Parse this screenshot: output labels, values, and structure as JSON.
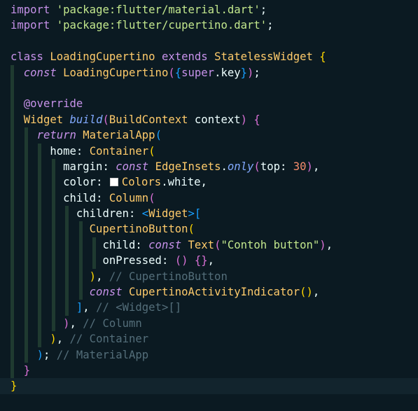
{
  "editor": {
    "language": "dart",
    "colors": {
      "background": "#0b1a22",
      "current_line": "#12242d",
      "keyword": "#c792ea",
      "string": "#c3e88d",
      "class": "#ffcb6b",
      "function": "#82aaff",
      "number": "#f78c6c",
      "comment": "#546e7a",
      "guide": "#1f3a30"
    },
    "current_line_index": 24,
    "lines": [
      {
        "indent": 0,
        "tokens": [
          {
            "t": "import",
            "c": "kw"
          },
          {
            "t": " "
          },
          {
            "t": "'package:flutter/material.dart'",
            "c": "str"
          },
          {
            "t": ";",
            "c": "id"
          }
        ]
      },
      {
        "indent": 0,
        "tokens": [
          {
            "t": "import",
            "c": "kw"
          },
          {
            "t": " "
          },
          {
            "t": "'package:flutter/cupertino.dart'",
            "c": "str"
          },
          {
            "t": ";",
            "c": "id"
          }
        ]
      },
      {
        "indent": 0,
        "tokens": []
      },
      {
        "indent": 0,
        "tokens": [
          {
            "t": "class",
            "c": "kw"
          },
          {
            "t": " "
          },
          {
            "t": "LoadingCupertino",
            "c": "cls"
          },
          {
            "t": " "
          },
          {
            "t": "extends",
            "c": "kw"
          },
          {
            "t": " "
          },
          {
            "t": "StatelessWidget",
            "c": "cls"
          },
          {
            "t": " "
          },
          {
            "t": "{",
            "c": "br1"
          }
        ]
      },
      {
        "indent": 1,
        "tokens": [
          {
            "t": "const",
            "c": "kwi"
          },
          {
            "t": " "
          },
          {
            "t": "LoadingCupertino",
            "c": "cls"
          },
          {
            "t": "(",
            "c": "br2"
          },
          {
            "t": "{",
            "c": "br3"
          },
          {
            "t": "super",
            "c": "kw"
          },
          {
            "t": ".",
            "c": "id"
          },
          {
            "t": "key",
            "c": "prop"
          },
          {
            "t": "}",
            "c": "br3"
          },
          {
            "t": ")",
            "c": "br2"
          },
          {
            "t": ";",
            "c": "id"
          }
        ]
      },
      {
        "indent": 1,
        "tokens": []
      },
      {
        "indent": 1,
        "tokens": [
          {
            "t": "@override",
            "c": "kw"
          }
        ]
      },
      {
        "indent": 1,
        "tokens": [
          {
            "t": "Widget",
            "c": "cls"
          },
          {
            "t": " "
          },
          {
            "t": "build",
            "c": "fni"
          },
          {
            "t": "(",
            "c": "br2"
          },
          {
            "t": "BuildContext",
            "c": "cls"
          },
          {
            "t": " "
          },
          {
            "t": "context",
            "c": "id"
          },
          {
            "t": ")",
            "c": "br2"
          },
          {
            "t": " "
          },
          {
            "t": "{",
            "c": "br2"
          }
        ]
      },
      {
        "indent": 2,
        "tokens": [
          {
            "t": "return",
            "c": "kwi"
          },
          {
            "t": " "
          },
          {
            "t": "MaterialApp",
            "c": "cls"
          },
          {
            "t": "(",
            "c": "br3"
          }
        ]
      },
      {
        "indent": 3,
        "tokens": [
          {
            "t": "home",
            "c": "prop"
          },
          {
            "t": ": ",
            "c": "id"
          },
          {
            "t": "Container",
            "c": "cls"
          },
          {
            "t": "(",
            "c": "br1"
          }
        ]
      },
      {
        "indent": 4,
        "tokens": [
          {
            "t": "margin",
            "c": "prop"
          },
          {
            "t": ": ",
            "c": "id"
          },
          {
            "t": "const",
            "c": "kwi"
          },
          {
            "t": " "
          },
          {
            "t": "EdgeInsets",
            "c": "cls"
          },
          {
            "t": ".",
            "c": "id"
          },
          {
            "t": "only",
            "c": "fni"
          },
          {
            "t": "(",
            "c": "br2"
          },
          {
            "t": "top",
            "c": "prop"
          },
          {
            "t": ": ",
            "c": "id"
          },
          {
            "t": "30",
            "c": "num"
          },
          {
            "t": ")",
            "c": "br2"
          },
          {
            "t": ",",
            "c": "id"
          }
        ]
      },
      {
        "indent": 4,
        "tokens": [
          {
            "t": "color",
            "c": "prop"
          },
          {
            "t": ": ",
            "c": "id"
          },
          {
            "swatch": "#ffffff"
          },
          {
            "t": "Colors",
            "c": "cls"
          },
          {
            "t": ".",
            "c": "id"
          },
          {
            "t": "white",
            "c": "prop"
          },
          {
            "t": ",",
            "c": "id"
          }
        ]
      },
      {
        "indent": 4,
        "tokens": [
          {
            "t": "child",
            "c": "prop"
          },
          {
            "t": ": ",
            "c": "id"
          },
          {
            "t": "Column",
            "c": "cls"
          },
          {
            "t": "(",
            "c": "br2"
          }
        ]
      },
      {
        "indent": 5,
        "tokens": [
          {
            "t": "children",
            "c": "prop"
          },
          {
            "t": ": ",
            "c": "id"
          },
          {
            "t": "<",
            "c": "br3"
          },
          {
            "t": "Widget",
            "c": "cls"
          },
          {
            "t": ">",
            "c": "br3"
          },
          {
            "t": "[",
            "c": "br3"
          }
        ]
      },
      {
        "indent": 6,
        "tokens": [
          {
            "t": "CupertinoButton",
            "c": "cls"
          },
          {
            "t": "(",
            "c": "br1"
          }
        ]
      },
      {
        "indent": 7,
        "tokens": [
          {
            "t": "child",
            "c": "prop"
          },
          {
            "t": ": ",
            "c": "id"
          },
          {
            "t": "const",
            "c": "kwi"
          },
          {
            "t": " "
          },
          {
            "t": "Text",
            "c": "cls"
          },
          {
            "t": "(",
            "c": "br2"
          },
          {
            "t": "\"Contoh button\"",
            "c": "str"
          },
          {
            "t": ")",
            "c": "br2"
          },
          {
            "t": ",",
            "c": "id"
          }
        ]
      },
      {
        "indent": 7,
        "tokens": [
          {
            "t": "onPressed",
            "c": "prop"
          },
          {
            "t": ": ",
            "c": "id"
          },
          {
            "t": "()",
            "c": "br2"
          },
          {
            "t": " "
          },
          {
            "t": "{}",
            "c": "br2"
          },
          {
            "t": ",",
            "c": "id"
          }
        ]
      },
      {
        "indent": 6,
        "tokens": [
          {
            "t": ")",
            "c": "br1"
          },
          {
            "t": ", ",
            "c": "id"
          },
          {
            "t": "// CupertinoButton",
            "c": "cmt"
          }
        ]
      },
      {
        "indent": 6,
        "tokens": [
          {
            "t": "const",
            "c": "kwi"
          },
          {
            "t": " "
          },
          {
            "t": "CupertinoActivityIndicator",
            "c": "cls"
          },
          {
            "t": "(",
            "c": "br1"
          },
          {
            "t": ")",
            "c": "br1"
          },
          {
            "t": ",",
            "c": "id"
          }
        ]
      },
      {
        "indent": 5,
        "tokens": [
          {
            "t": "]",
            "c": "br3"
          },
          {
            "t": ", ",
            "c": "id"
          },
          {
            "t": "// <Widget>[]",
            "c": "cmt"
          }
        ]
      },
      {
        "indent": 4,
        "tokens": [
          {
            "t": ")",
            "c": "br2"
          },
          {
            "t": ", ",
            "c": "id"
          },
          {
            "t": "// Column",
            "c": "cmt"
          }
        ]
      },
      {
        "indent": 3,
        "tokens": [
          {
            "t": ")",
            "c": "br1"
          },
          {
            "t": ", ",
            "c": "id"
          },
          {
            "t": "// Container",
            "c": "cmt"
          }
        ]
      },
      {
        "indent": 2,
        "tokens": [
          {
            "t": ")",
            "c": "br3"
          },
          {
            "t": "; ",
            "c": "id"
          },
          {
            "t": "// MaterialApp",
            "c": "cmt"
          }
        ]
      },
      {
        "indent": 1,
        "tokens": [
          {
            "t": "}",
            "c": "br2"
          }
        ]
      },
      {
        "indent": 0,
        "tokens": [
          {
            "t": "}",
            "c": "br1"
          }
        ]
      }
    ]
  }
}
